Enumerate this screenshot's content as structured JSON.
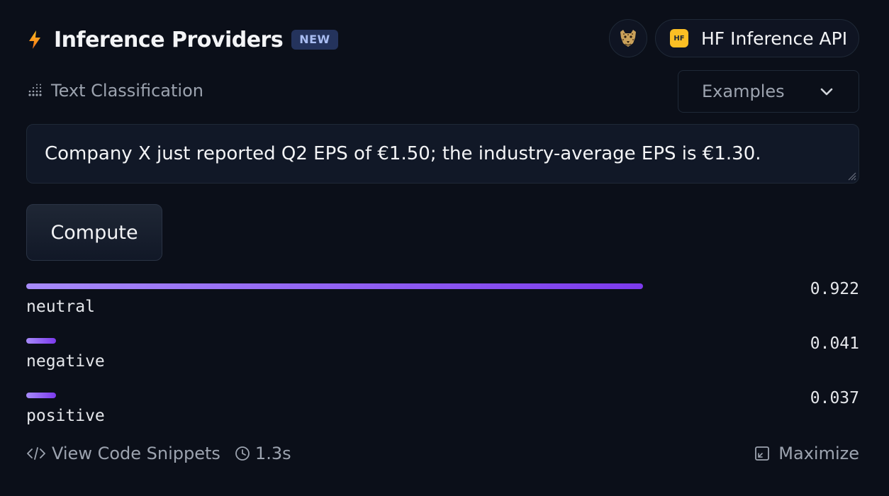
{
  "header": {
    "title": "Inference Providers",
    "badge": "NEW",
    "provider_logo_icon": "cheetah-icon",
    "provider_icon": "hf-icon",
    "provider_icon_text": "HF",
    "provider_name": "HF Inference API"
  },
  "task": {
    "icon": "text-classification-icon",
    "label": "Text Classification"
  },
  "examples": {
    "label": "Examples",
    "icon": "chevron-down-icon"
  },
  "input": {
    "value": "Company X just reported Q2 EPS of €1.50; the industry-average EPS is €1.30."
  },
  "compute": {
    "label": "Compute"
  },
  "results": [
    {
      "label": "neutral",
      "score": "0.922",
      "value": 0.922
    },
    {
      "label": "negative",
      "score": "0.041",
      "value": 0.041
    },
    {
      "label": "positive",
      "score": "0.037",
      "value": 0.037
    }
  ],
  "footer": {
    "code_snippets": "View Code Snippets",
    "time": "1.3s",
    "maximize": "Maximize"
  },
  "colors": {
    "background": "#0b0f19",
    "bar_start": "#a78bfa",
    "bar_end": "#7c3aed",
    "badge_bg": "#24335c",
    "hf_yellow": "#fbbf24"
  }
}
